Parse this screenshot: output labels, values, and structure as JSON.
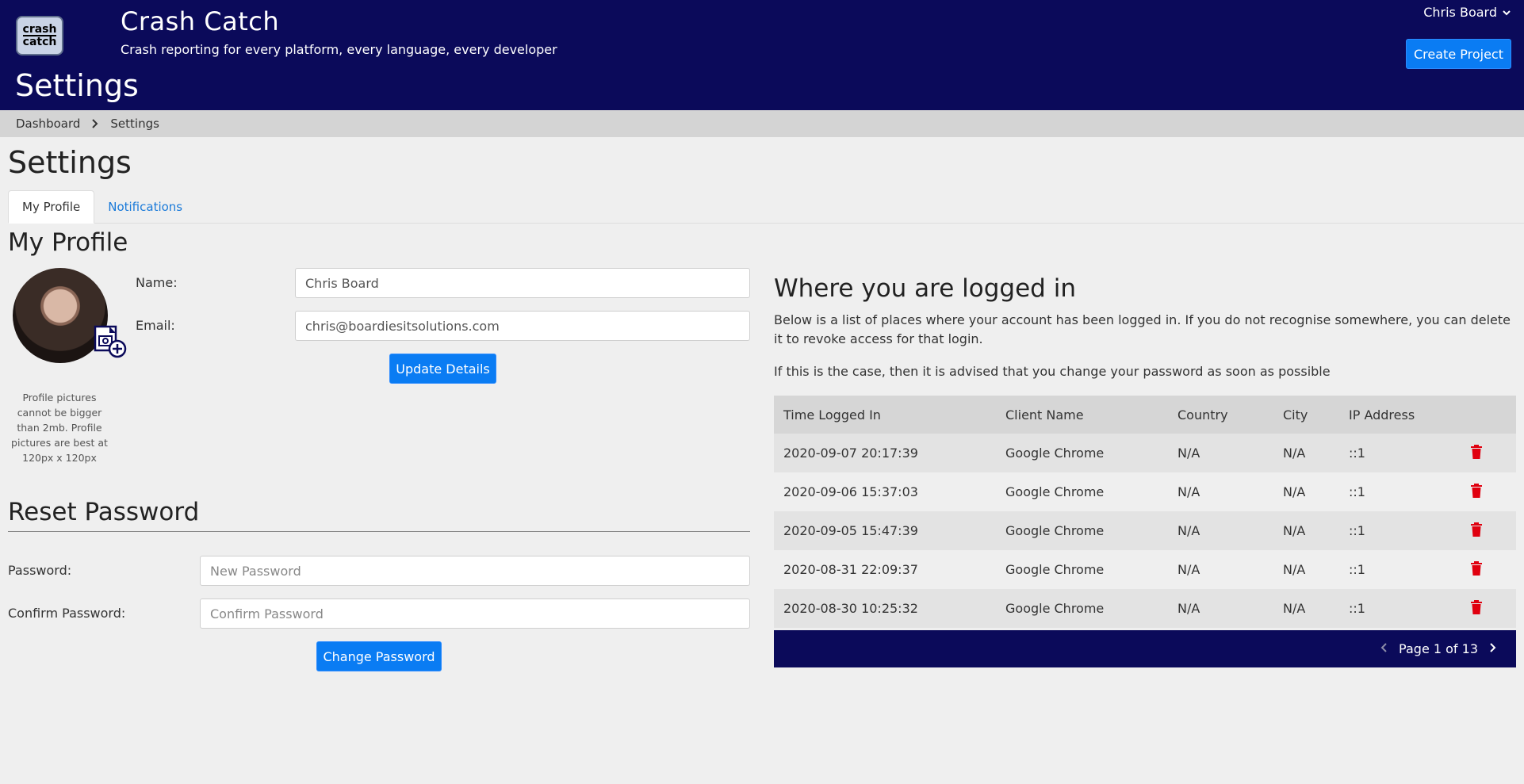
{
  "header": {
    "logo_text_top": "crash",
    "logo_text_bottom": "catch",
    "app_title": "Crash Catch",
    "tagline": "Crash reporting for every platform, every language, every developer",
    "page_heading": "Settings",
    "user_name": "Chris Board",
    "create_project_label": "Create Project",
    "brand_color": "#0b0a5a",
    "accent_color": "#0a7cf3"
  },
  "breadcrumb": {
    "items": [
      "Dashboard",
      "Settings"
    ]
  },
  "settings": {
    "title": "Settings",
    "tabs": [
      {
        "label": "My Profile",
        "active": true
      },
      {
        "label": "Notifications",
        "active": false
      }
    ]
  },
  "profile": {
    "section_title": "My Profile",
    "avatar_note": "Profile pictures cannot be bigger than 2mb. Profile pictures are best at 120px x 120px",
    "name_label": "Name:",
    "name_value": "Chris Board",
    "email_label": "Email:",
    "email_value": "chris@boardiesitsolutions.com",
    "update_button": "Update Details"
  },
  "reset_password": {
    "section_title": "Reset Password",
    "password_label": "Password:",
    "password_placeholder": "New Password",
    "confirm_label": "Confirm Password:",
    "confirm_placeholder": "Confirm Password",
    "change_button": "Change Password"
  },
  "logins": {
    "title": "Where you are logged in",
    "description": "Below is a list of places where your account has been logged in. If you do not recognise somewhere, you can delete it to revoke access for that login.",
    "advice": "If this is the case, then it is advised that you change your password as soon as possible",
    "columns": [
      "Time Logged In",
      "Client Name",
      "Country",
      "City",
      "IP Address"
    ],
    "rows": [
      {
        "time": "2020-09-07 20:17:39",
        "client": "Google Chrome",
        "country": "N/A",
        "city": "N/A",
        "ip": "::1"
      },
      {
        "time": "2020-09-06 15:37:03",
        "client": "Google Chrome",
        "country": "N/A",
        "city": "N/A",
        "ip": "::1"
      },
      {
        "time": "2020-09-05 15:47:39",
        "client": "Google Chrome",
        "country": "N/A",
        "city": "N/A",
        "ip": "::1"
      },
      {
        "time": "2020-08-31 22:09:37",
        "client": "Google Chrome",
        "country": "N/A",
        "city": "N/A",
        "ip": "::1"
      },
      {
        "time": "2020-08-30 10:25:32",
        "client": "Google Chrome",
        "country": "N/A",
        "city": "N/A",
        "ip": "::1"
      }
    ],
    "delete_icon": "trash-icon",
    "delete_color": "#e0000f",
    "pager_text": "Page 1 of 13"
  }
}
